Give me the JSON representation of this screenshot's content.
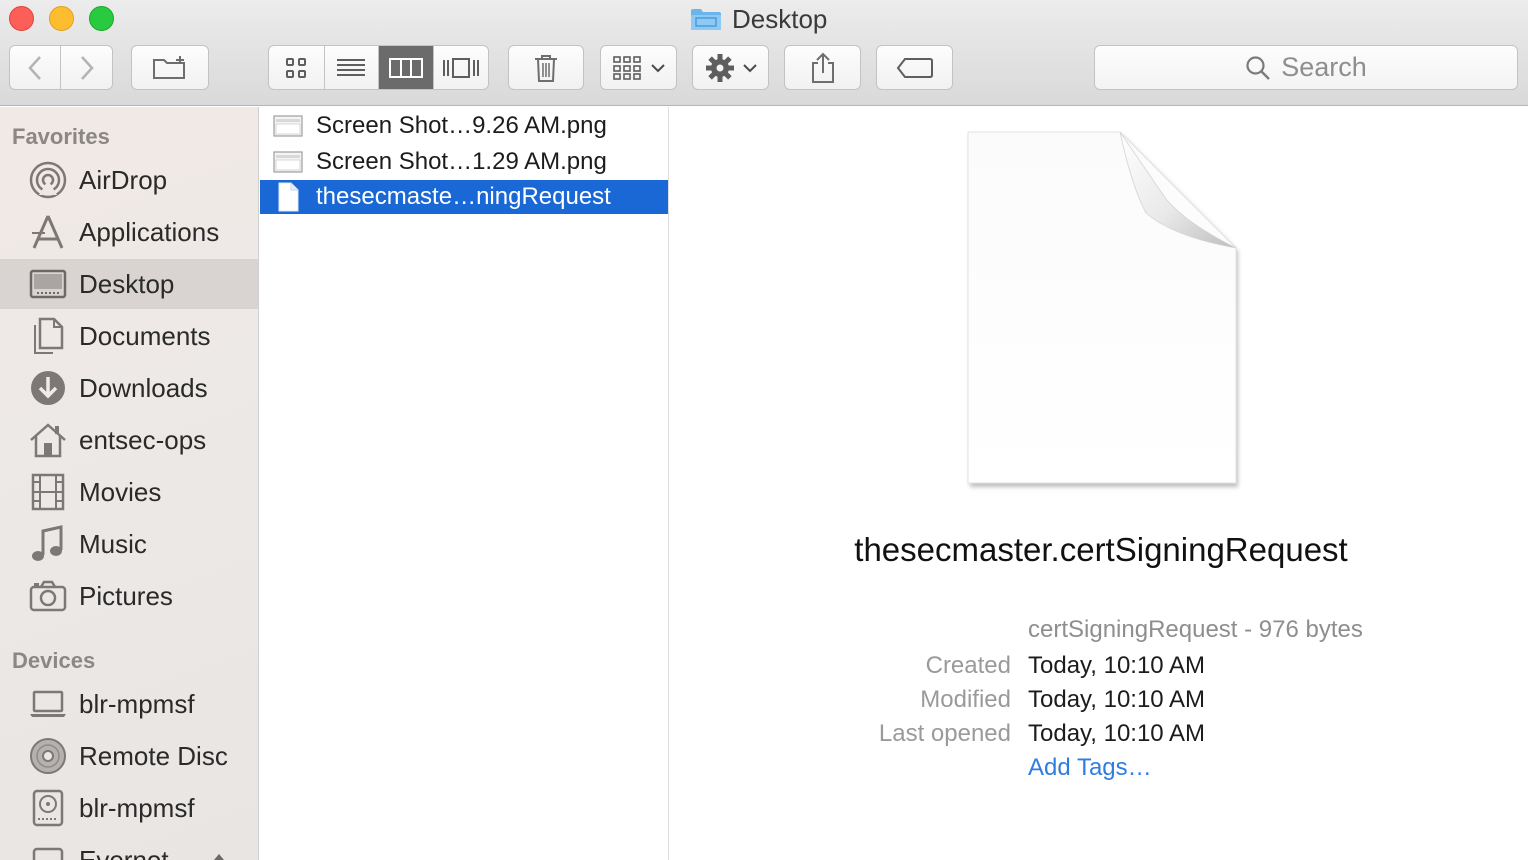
{
  "window": {
    "title": "Desktop"
  },
  "toolbar": {
    "back_icon": "chevron-left-icon",
    "forward_icon": "chevron-right-icon",
    "new_folder_icon": "new-folder-icon",
    "views": [
      "icon-view",
      "list-view",
      "column-view",
      "cover-flow-view"
    ],
    "active_view": "column-view",
    "search_placeholder": "Search"
  },
  "sidebar": {
    "favorites_heading": "Favorites",
    "favorites": [
      {
        "label": "AirDrop",
        "icon": "airdrop-icon"
      },
      {
        "label": "Applications",
        "icon": "applications-icon"
      },
      {
        "label": "Desktop",
        "icon": "desktop-icon",
        "selected": true
      },
      {
        "label": "Documents",
        "icon": "documents-icon"
      },
      {
        "label": "Downloads",
        "icon": "downloads-icon"
      },
      {
        "label": "entsec-ops",
        "icon": "home-icon"
      },
      {
        "label": "Movies",
        "icon": "movies-icon"
      },
      {
        "label": "Music",
        "icon": "music-icon"
      },
      {
        "label": "Pictures",
        "icon": "pictures-icon"
      }
    ],
    "devices_heading": "Devices",
    "devices": [
      {
        "label": "blr-mpmsf",
        "icon": "laptop-icon"
      },
      {
        "label": "Remote Disc",
        "icon": "disc-icon"
      },
      {
        "label": "blr-mpmsf",
        "icon": "hard-drive-icon"
      },
      {
        "label": "Evernot",
        "icon": "drive-icon"
      }
    ]
  },
  "files": [
    {
      "name": "Screen Shot…9.26 AM.png",
      "icon": "image-file-icon"
    },
    {
      "name": "Screen Shot…1.29 AM.png",
      "icon": "image-file-icon"
    },
    {
      "name": "thesecmaste…ningRequest",
      "icon": "document-file-icon",
      "selected": true
    }
  ],
  "preview": {
    "filename": "thesecmaster.certSigningRequest",
    "kind": "certSigningRequest - 976 bytes",
    "created_label": "Created",
    "created_value": "Today, 10:10 AM",
    "modified_label": "Modified",
    "modified_value": "Today, 10:10 AM",
    "opened_label": "Last opened",
    "opened_value": "Today, 10:10 AM",
    "add_tags": "Add Tags…"
  },
  "colors": {
    "selection": "#1a68d6",
    "link": "#2f7de1",
    "close": "#fc5f57",
    "minimize": "#fdbd2e",
    "zoom": "#29c940"
  }
}
